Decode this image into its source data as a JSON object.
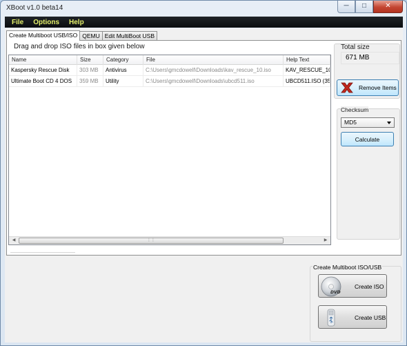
{
  "window": {
    "title": "XBoot v1.0 beta14"
  },
  "menu": [
    "File",
    "Options",
    "Help"
  ],
  "tabs": [
    "Create Multiboot USB/ISO",
    "QEMU",
    "Edit MultiBoot USB"
  ],
  "drop_label": "Drag and drop ISO files in box given below",
  "table": {
    "columns": [
      "Name",
      "Size",
      "Category",
      "File",
      "Help Text"
    ],
    "rows": [
      [
        "Kaspersky Rescue Disk",
        "303 MB",
        "Antivirus",
        "C:\\Users\\gmcdowell\\Downloads\\kav_rescue_10.iso",
        "KAV_RESCUE_10"
      ],
      [
        "Ultimate Boot CD 4 DOS",
        "359 MB",
        "Utility",
        "C:\\Users\\gmcdowell\\Downloads\\ubcd511.iso",
        "UBCD511.ISO  (35"
      ]
    ]
  },
  "total_size": {
    "label": "Total size",
    "value": "671 MB"
  },
  "remove_button": "Remove Items",
  "checksum": {
    "label": "Checksum",
    "selected": "MD5",
    "button": "Calculate"
  },
  "create": {
    "label": "Create Multiboot ISO/USB",
    "iso_button": "Create ISO",
    "usb_button": "Create USB",
    "dvd_text": "DVD"
  },
  "colors": {
    "menubar": "#0b0d0f",
    "menu_text": "#e3ef6a",
    "remove_icon": "#c0281e"
  }
}
